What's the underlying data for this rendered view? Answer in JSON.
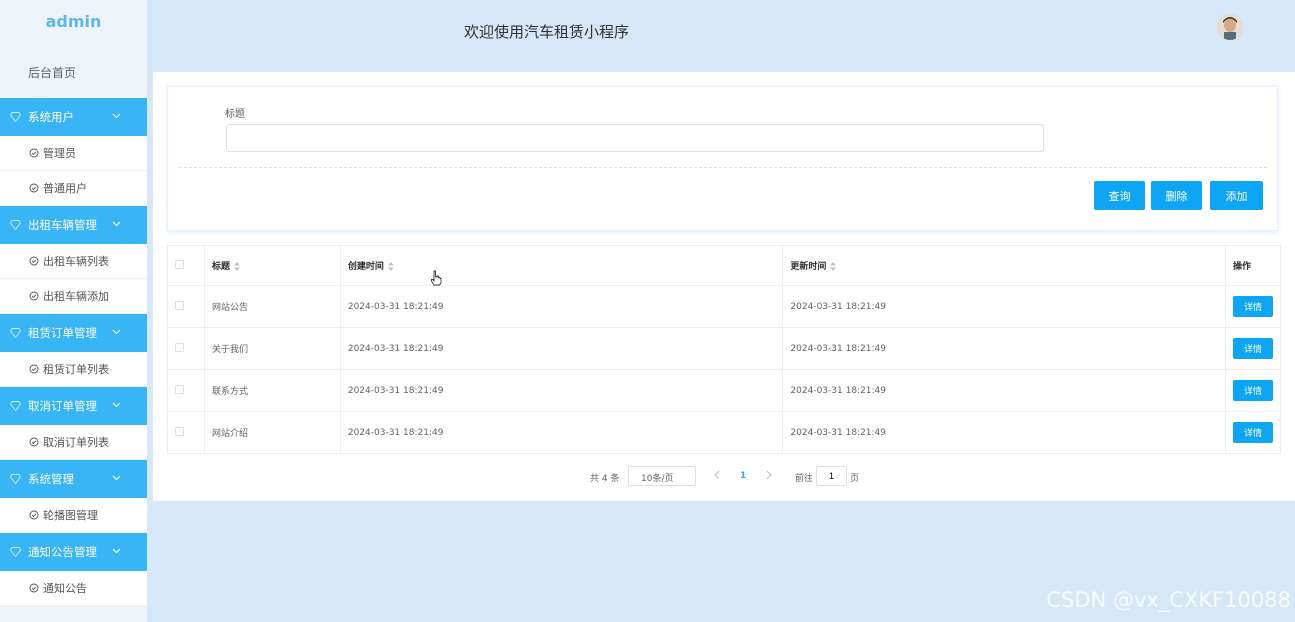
{
  "sidebar": {
    "logo": "admin",
    "home": "后台首页",
    "groups": [
      {
        "label": "系统用户",
        "items": [
          "管理员",
          "普通用户"
        ]
      },
      {
        "label": "出租车辆管理",
        "items": [
          "出租车辆列表",
          "出租车辆添加"
        ]
      },
      {
        "label": "租赁订单管理",
        "items": [
          "租赁订单列表"
        ]
      },
      {
        "label": "取消订单管理",
        "items": [
          "取消订单列表"
        ]
      },
      {
        "label": "系统管理",
        "items": [
          "轮播图管理"
        ]
      },
      {
        "label": "通知公告管理",
        "items": [
          "通知公告"
        ]
      }
    ]
  },
  "header": {
    "title": "欢迎使用汽车租赁小程序"
  },
  "search": {
    "label": "标题",
    "value": "",
    "query_btn": "查询",
    "delete_btn": "删除",
    "add_btn": "添加"
  },
  "table": {
    "columns": [
      "标题",
      "创建时间",
      "更新时间",
      "操作"
    ],
    "rows": [
      {
        "title": "网站公告",
        "created": "2024-03-31 18:21:49",
        "updated": "2024-03-31 18:21:49",
        "action": "详情"
      },
      {
        "title": "关于我们",
        "created": "2024-03-31 18:21:49",
        "updated": "2024-03-31 18:21:49",
        "action": "详情"
      },
      {
        "title": "联系方式",
        "created": "2024-03-31 18:21:49",
        "updated": "2024-03-31 18:21:49",
        "action": "详情"
      },
      {
        "title": "网站介绍",
        "created": "2024-03-31 18:21:49",
        "updated": "2024-03-31 18:21:49",
        "action": "详情"
      }
    ]
  },
  "pager": {
    "total": "共 4 条",
    "page_size": "10条/页",
    "current_page": "1",
    "goto_label": "前往",
    "goto_value": "1",
    "page_unit": "页"
  },
  "watermark": "CSDN @vx_CXKF10088",
  "colors": {
    "accent": "#37b5f4",
    "button": "#0ea5f5",
    "background": "#d6e8f7"
  }
}
